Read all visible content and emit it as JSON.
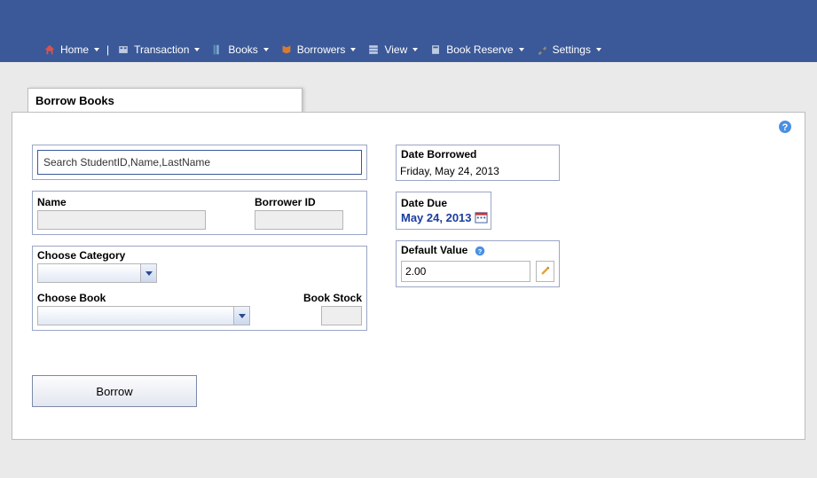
{
  "nav": {
    "home": "Home",
    "transaction": "Transaction",
    "books": "Books",
    "borrowers": "Borrowers",
    "view": "View",
    "bookreserve": "Book Reserve",
    "settings": "Settings"
  },
  "tab": {
    "title": "Borrow Books"
  },
  "search": {
    "placeholder": "Search StudentID,Name,LastName"
  },
  "labels": {
    "name": "Name",
    "borrower_id": "Borrower ID",
    "choose_category": "Choose Category",
    "choose_book": "Choose Book",
    "book_stock": "Book Stock",
    "date_borrowed": "Date Borrowed",
    "date_due": "Date Due",
    "default_value": "Default Value"
  },
  "values": {
    "name": "",
    "borrower_id": "",
    "category": "",
    "book": "",
    "book_stock": "",
    "date_borrowed": "Friday, May 24, 2013",
    "date_due": "May 24, 2013",
    "default_value": "2.00"
  },
  "buttons": {
    "borrow": "Borrow"
  }
}
